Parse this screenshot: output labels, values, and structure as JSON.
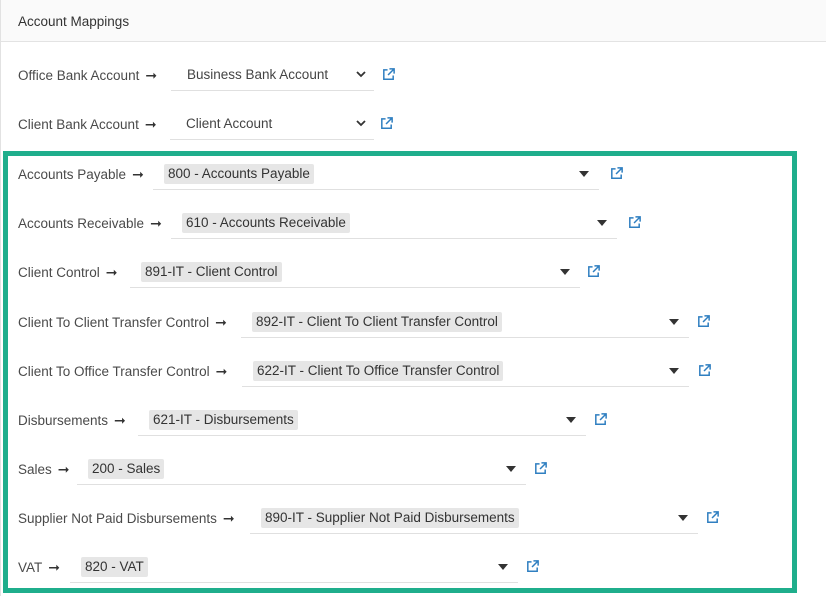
{
  "panel": {
    "title": "Account Mappings"
  },
  "arrow_glyph": "➞",
  "mappings": [
    {
      "label": "Office Bank Account",
      "value": "Business Bank Account"
    },
    {
      "label": "Client Bank Account",
      "value": "Client Account"
    },
    {
      "label": "Accounts Payable",
      "value": "800 - Accounts Payable"
    },
    {
      "label": "Accounts Receivable",
      "value": "610 - Accounts Receivable"
    },
    {
      "label": "Client Control",
      "value": "891-IT - Client Control"
    },
    {
      "label": "Client To Client Transfer Control",
      "value": "892-IT - Client To Client Transfer Control"
    },
    {
      "label": "Client To Office Transfer Control",
      "value": "622-IT - Client To Office Transfer Control"
    },
    {
      "label": "Disbursements",
      "value": "621-IT - Disbursements"
    },
    {
      "label": "Sales",
      "value": "200 - Sales"
    },
    {
      "label": "Supplier Not Paid Disbursements",
      "value": "890-IT - Supplier Not Paid Disbursements"
    },
    {
      "label": "VAT",
      "value": "820 - VAT"
    }
  ],
  "colors": {
    "highlight": "#1fae8c",
    "link_icon": "#2f7fc1"
  },
  "icons": {
    "external_link": "external-link-icon",
    "dropdown": "chevron-down-icon",
    "caret": "caret-down-icon"
  }
}
